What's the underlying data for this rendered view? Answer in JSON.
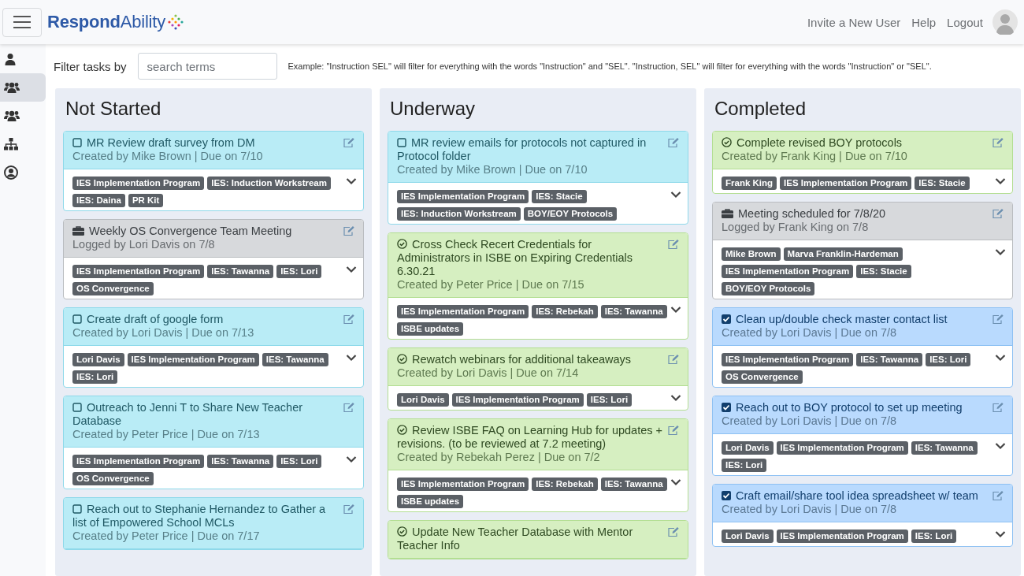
{
  "header": {
    "logo": "**Respond**Ability",
    "links": [
      "Invite a New User",
      "Help",
      "Logout"
    ]
  },
  "sidebar": {
    "items": [
      {
        "kind": "person",
        "selected": false
      },
      {
        "kind": "group",
        "selected": true
      },
      {
        "kind": "group",
        "selected": false
      },
      {
        "kind": "sitemap",
        "selected": false
      },
      {
        "kind": "person-circle",
        "selected": false
      }
    ]
  },
  "filter": {
    "label": "Filter tasks by",
    "placeholder": "search terms",
    "hint": "Example: \"Instruction SEL\" will filter for everything with the words \"Instruction\" and \"SEL\". \"Instruction, SEL\" will filter for everything with the words \"Instruction\" or \"SEL\"."
  },
  "columns": [
    {
      "title": "Not Started",
      "cards": [
        {
          "kind": "todo",
          "title": "MR Review draft survey from DM",
          "meta": "Created by Mike Brown | Due on 7/10",
          "tags": [
            "IES Implementation Program",
            "IES: Induction Workstream",
            "IES: Daina",
            "PR Kit"
          ]
        },
        {
          "kind": "meeting",
          "title": "Weekly OS Convergence Team Meeting",
          "meta": "Logged by Lori Davis on 7/8",
          "tags": [
            "IES Implementation Program",
            "IES: Tawanna",
            "IES: Lori",
            "OS Convergence"
          ]
        },
        {
          "kind": "todo",
          "title": "Create draft of google form",
          "meta": "Created by Lori Davis | Due on 7/13",
          "tags": [
            "Lori Davis",
            "IES Implementation Program",
            "IES: Tawanna",
            "IES: Lori"
          ]
        },
        {
          "kind": "todo",
          "title": "Outreach to Jenni T to Share New Teacher Database",
          "meta": "Created by Peter Price | Due on 7/13",
          "tags": [
            "IES Implementation Program",
            "IES: Tawanna",
            "IES: Lori",
            "OS Convergence"
          ]
        },
        {
          "kind": "todo",
          "title": "Reach out to Stephanie Hernandez to Gather a list of Empowered School MCLs",
          "meta": "Created by Peter Price | Due on 7/17"
        }
      ]
    },
    {
      "title": "Underway",
      "cards": [
        {
          "kind": "todo",
          "title": "MR review emails for protocols not captured in Protocol folder",
          "meta": "Created by Mike Brown | Due on 7/10",
          "tags": [
            "IES Implementation Program",
            "IES: Stacie",
            "IES: Induction Workstream",
            "BOY/EOY Protocols"
          ]
        },
        {
          "kind": "done",
          "title": "Cross Check Recert Credentials for Administrators in ISBE on Expiring Credentials 6.30.21",
          "meta": "Created by Peter Price | Due on 7/15",
          "tags": [
            "IES Implementation Program",
            "IES: Rebekah",
            "IES: Tawanna",
            "ISBE updates"
          ]
        },
        {
          "kind": "done",
          "title": "Rewatch webinars for additional takeaways",
          "meta": "Created by Lori Davis | Due on 7/14",
          "tags": [
            "Lori Davis",
            "IES Implementation Program",
            "IES: Lori"
          ]
        },
        {
          "kind": "done",
          "title": "Review ISBE FAQ on Learning Hub for updates + revisions. (to be reviewed at 7.2 meeting)",
          "meta": "Created by Rebekah Perez | Due on 7/2",
          "tags": [
            "IES Implementation Program",
            "IES: Rebekah",
            "IES: Tawanna",
            "ISBE updates"
          ]
        },
        {
          "kind": "done",
          "title": "Update New Teacher Database with Mentor Teacher Info"
        }
      ]
    },
    {
      "title": "Completed",
      "cards": [
        {
          "kind": "done",
          "title": "Complete revised BOY protocols",
          "meta": "Created by Frank King | Due on 7/10",
          "tags": [
            "Frank King",
            "IES Implementation Program",
            "IES: Stacie"
          ]
        },
        {
          "kind": "meeting",
          "title": "Meeting scheduled for 7/8/20",
          "meta": "Logged by Frank King on 7/8",
          "tags": [
            "Mike Brown",
            "Marva Franklin-Hardeman",
            "IES Implementation Program",
            "IES: Stacie",
            "BOY/EOY Protocols"
          ]
        },
        {
          "kind": "checked",
          "title": "Clean up/double check master contact list",
          "meta": "Created by Lori Davis | Due on 7/8",
          "tags": [
            "IES Implementation Program",
            "IES: Tawanna",
            "IES: Lori",
            "OS Convergence"
          ]
        },
        {
          "kind": "checked",
          "title": "Reach out to BOY protocol to set up meeting",
          "meta": "Created by Lori Davis | Due on 7/8",
          "tags": [
            "Lori Davis",
            "IES Implementation Program",
            "IES: Tawanna",
            "IES: Lori"
          ]
        },
        {
          "kind": "checked",
          "title": "Craft email/share tool idea spreadsheet w/ team",
          "meta": "Created by Lori Davis | Due on 7/8",
          "tags": [
            "Lori Davis",
            "IES Implementation Program",
            "IES: Lori"
          ]
        }
      ]
    }
  ]
}
